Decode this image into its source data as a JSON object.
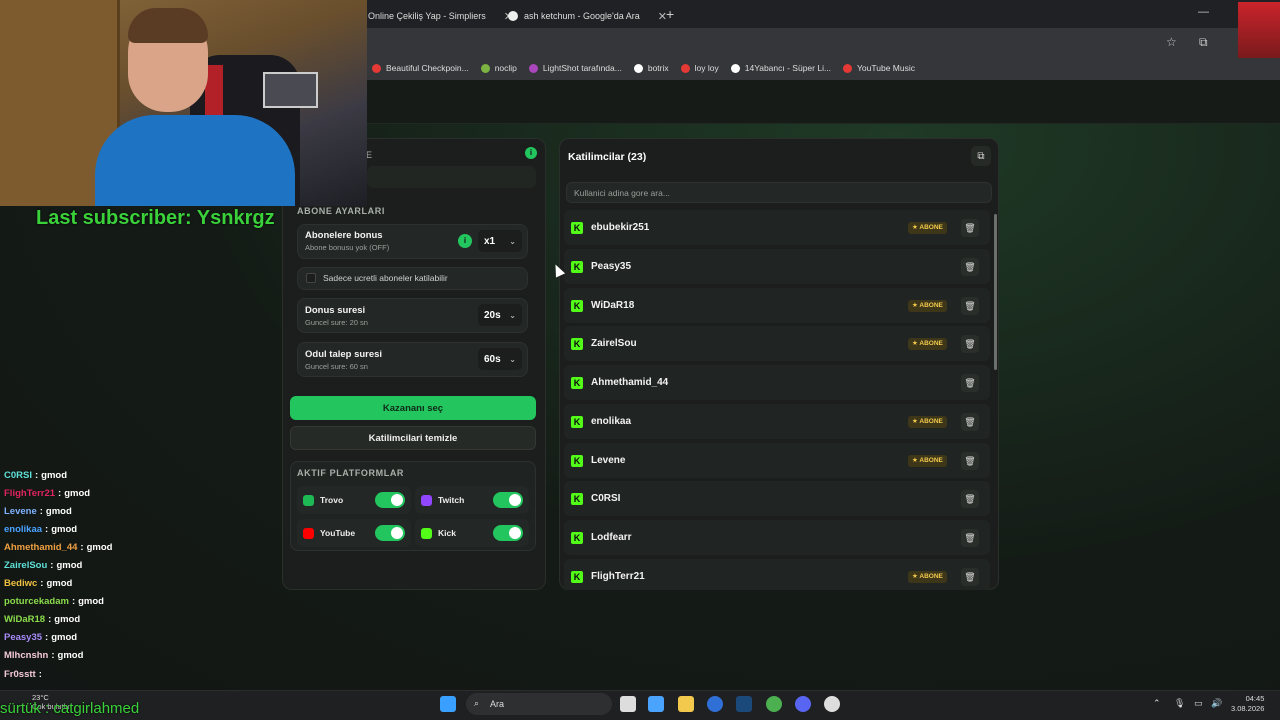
{
  "browser": {
    "tabs": [
      {
        "title": "Online Çekiliş Yap - Simpliers"
      },
      {
        "title": "ash ketchum - Google'da Ara"
      }
    ],
    "new_tab": "+",
    "bookmarks": [
      {
        "label": "Beautiful Checkpoin...",
        "color": "#e53935"
      },
      {
        "label": "noclip",
        "color": "#7cb342"
      },
      {
        "label": "LightShot tarafında...",
        "color": "#ab47bc"
      },
      {
        "label": "botrix",
        "color": "#ffffff"
      },
      {
        "label": "loy loy",
        "color": "#e53935"
      },
      {
        "label": "14Yabancı - Süper Li...",
        "color": "#ffffff"
      },
      {
        "label": "YouTube Music",
        "color": "#e53935"
      }
    ]
  },
  "left_panel": {
    "header_glyph": "E",
    "status_dot": "i",
    "subscriber_section_title": "ABONE AYARLARI",
    "bonus": {
      "title": "Abonelere bonus",
      "sub": "Abone bonusu yok (OFF)",
      "info": "i",
      "value": "x1"
    },
    "paid_only_label": "Sadece ucretli aboneler katilabilir",
    "duration": {
      "title": "Donus suresi",
      "sub": "Guncel sure: 20 sn",
      "value": "20s"
    },
    "claim": {
      "title": "Odul talep suresi",
      "sub": "Guncel sure: 60 sn",
      "value": "60s"
    },
    "pick_winner_label": "Kazananı seç",
    "clear_participants_label": "Katilimcilari temizle",
    "platforms_section_title": "AKTIF PLATFORMLAR",
    "platforms": [
      {
        "name": "Trovo",
        "color": "#1db954",
        "enabled": true
      },
      {
        "name": "Twitch",
        "color": "#9146ff",
        "enabled": true
      },
      {
        "name": "YouTube",
        "color": "#ff0000",
        "enabled": true
      },
      {
        "name": "Kick",
        "color": "#53fc18",
        "enabled": true
      }
    ]
  },
  "participants": {
    "title": "Katilimcilar (23)",
    "search_placeholder": "Kullanici adina gore ara...",
    "badge_label": "★ ABONE",
    "items": [
      {
        "name": "ebubekir251",
        "subscriber": true
      },
      {
        "name": "Peasy35",
        "subscriber": false
      },
      {
        "name": "WiDaR18",
        "subscriber": true
      },
      {
        "name": "ZairelSou",
        "subscriber": true
      },
      {
        "name": "Ahmethamid_44",
        "subscriber": false
      },
      {
        "name": "enolikaa",
        "subscriber": true
      },
      {
        "name": "Levene",
        "subscriber": true
      },
      {
        "name": "C0RSI",
        "subscriber": false
      },
      {
        "name": "Lodfearr",
        "subscriber": false
      },
      {
        "name": "FlighTerr21",
        "subscriber": true
      }
    ]
  },
  "overlay": {
    "last_subscriber": "Last subscriber: Ysnkrgz",
    "bottom_text": "sürtük : catgirlahmed",
    "chat": [
      {
        "user": "C0RSI",
        "msg": "gmod",
        "color": "#5ee1d6"
      },
      {
        "user": "FlighTerr21",
        "msg": "gmod",
        "color": "#e0245e"
      },
      {
        "user": "Levene",
        "msg": "gmod",
        "color": "#7fb2ff"
      },
      {
        "user": "enolikaa",
        "msg": "gmod",
        "color": "#4aa3ff"
      },
      {
        "user": "Ahmethamid_44",
        "msg": "gmod",
        "color": "#f0a040"
      },
      {
        "user": "ZairelSou",
        "msg": "gmod",
        "color": "#5ee1d6"
      },
      {
        "user": "Bediwc",
        "msg": "gmod",
        "color": "#f0c040"
      },
      {
        "user": "poturcekadam",
        "msg": "gmod",
        "color": "#8bdc4a"
      },
      {
        "user": "WiDaR18",
        "msg": "gmod",
        "color": "#8bdc4a"
      },
      {
        "user": "Peasy35",
        "msg": "gmod",
        "color": "#a78bfa"
      },
      {
        "user": "Mlhcnshn",
        "msg": "gmod",
        "color": "#f3c9d8"
      },
      {
        "user": "Fr0sstt",
        "msg": "",
        "color": "#f3c9d8"
      }
    ]
  },
  "taskbar": {
    "weather_temp": "23°C",
    "weather_desc": "Çok bulutlu",
    "search_label": "Ara",
    "time": "04:45",
    "date": "3.08.2026"
  }
}
